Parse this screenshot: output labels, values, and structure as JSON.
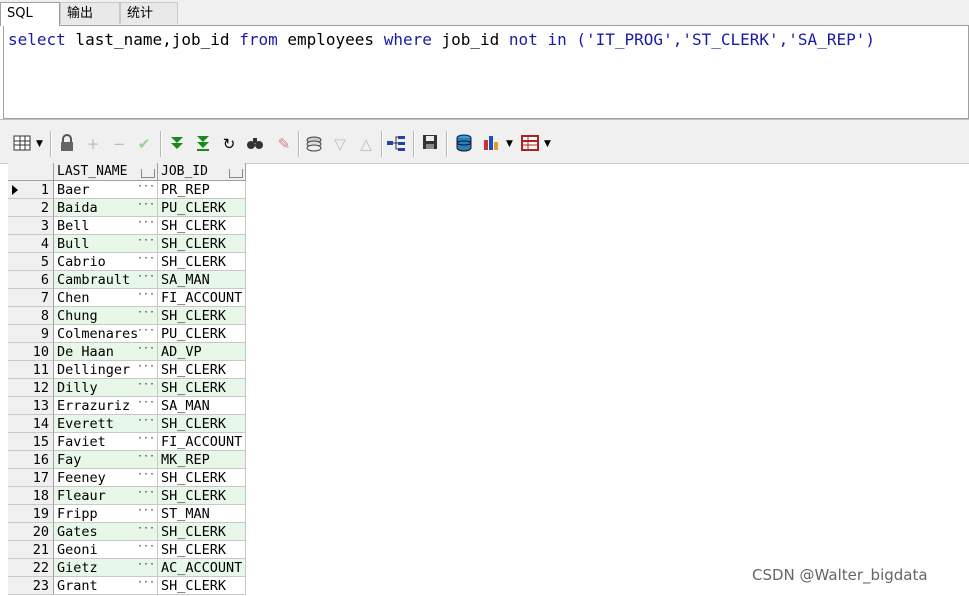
{
  "tabs": [
    {
      "label": "SQL"
    },
    {
      "label": "输出"
    },
    {
      "label": "统计"
    }
  ],
  "editor": {
    "kw_select": "select",
    "cols": " last_name,job_id ",
    "kw_from": "from",
    "table": " employees ",
    "kw_where": "where",
    "col": " job_id ",
    "kw_not": "not",
    "kw_in": "in",
    "list": " ('IT_PROG','ST_CLERK','SA_REP')"
  },
  "toolbar": {
    "icons": [
      "grid-icon",
      "lock-icon",
      "plus-icon",
      "minus-icon",
      "check-icon",
      "fetch-next-icon",
      "fetch-all-icon",
      "refresh-icon",
      "find-icon",
      "clear-icon",
      "query-icon",
      "filter-down-icon",
      "filter-up-icon",
      "tree-icon",
      "save-icon",
      "db-icon",
      "chart-icon",
      "table-icon"
    ]
  },
  "grid": {
    "columns": [
      "LAST_NAME",
      "JOB_ID"
    ],
    "rows": [
      {
        "n": "1",
        "last_name": "Baer",
        "job_id": "PR_REP"
      },
      {
        "n": "2",
        "last_name": "Baida",
        "job_id": "PU_CLERK"
      },
      {
        "n": "3",
        "last_name": "Bell",
        "job_id": "SH_CLERK"
      },
      {
        "n": "4",
        "last_name": "Bull",
        "job_id": "SH_CLERK"
      },
      {
        "n": "5",
        "last_name": "Cabrio",
        "job_id": "SH_CLERK"
      },
      {
        "n": "6",
        "last_name": "Cambrault",
        "job_id": "SA_MAN"
      },
      {
        "n": "7",
        "last_name": "Chen",
        "job_id": "FI_ACCOUNT"
      },
      {
        "n": "8",
        "last_name": "Chung",
        "job_id": "SH_CLERK"
      },
      {
        "n": "9",
        "last_name": "Colmenares",
        "job_id": "PU_CLERK"
      },
      {
        "n": "10",
        "last_name": "De Haan",
        "job_id": "AD_VP"
      },
      {
        "n": "11",
        "last_name": "Dellinger",
        "job_id": "SH_CLERK"
      },
      {
        "n": "12",
        "last_name": "Dilly",
        "job_id": "SH_CLERK"
      },
      {
        "n": "13",
        "last_name": "Errazuriz",
        "job_id": "SA_MAN"
      },
      {
        "n": "14",
        "last_name": "Everett",
        "job_id": "SH_CLERK"
      },
      {
        "n": "15",
        "last_name": "Faviet",
        "job_id": "FI_ACCOUNT"
      },
      {
        "n": "16",
        "last_name": "Fay",
        "job_id": "MK_REP"
      },
      {
        "n": "17",
        "last_name": "Feeney",
        "job_id": "SH_CLERK"
      },
      {
        "n": "18",
        "last_name": "Fleaur",
        "job_id": "SH_CLERK"
      },
      {
        "n": "19",
        "last_name": "Fripp",
        "job_id": "ST_MAN"
      },
      {
        "n": "20",
        "last_name": "Gates",
        "job_id": "SH_CLERK"
      },
      {
        "n": "21",
        "last_name": "Geoni",
        "job_id": "SH_CLERK"
      },
      {
        "n": "22",
        "last_name": "Gietz",
        "job_id": "AC_ACCOUNT"
      },
      {
        "n": "23",
        "last_name": "Grant",
        "job_id": "SH_CLERK"
      }
    ]
  },
  "watermark": "CSDN @Walter_bigdata"
}
